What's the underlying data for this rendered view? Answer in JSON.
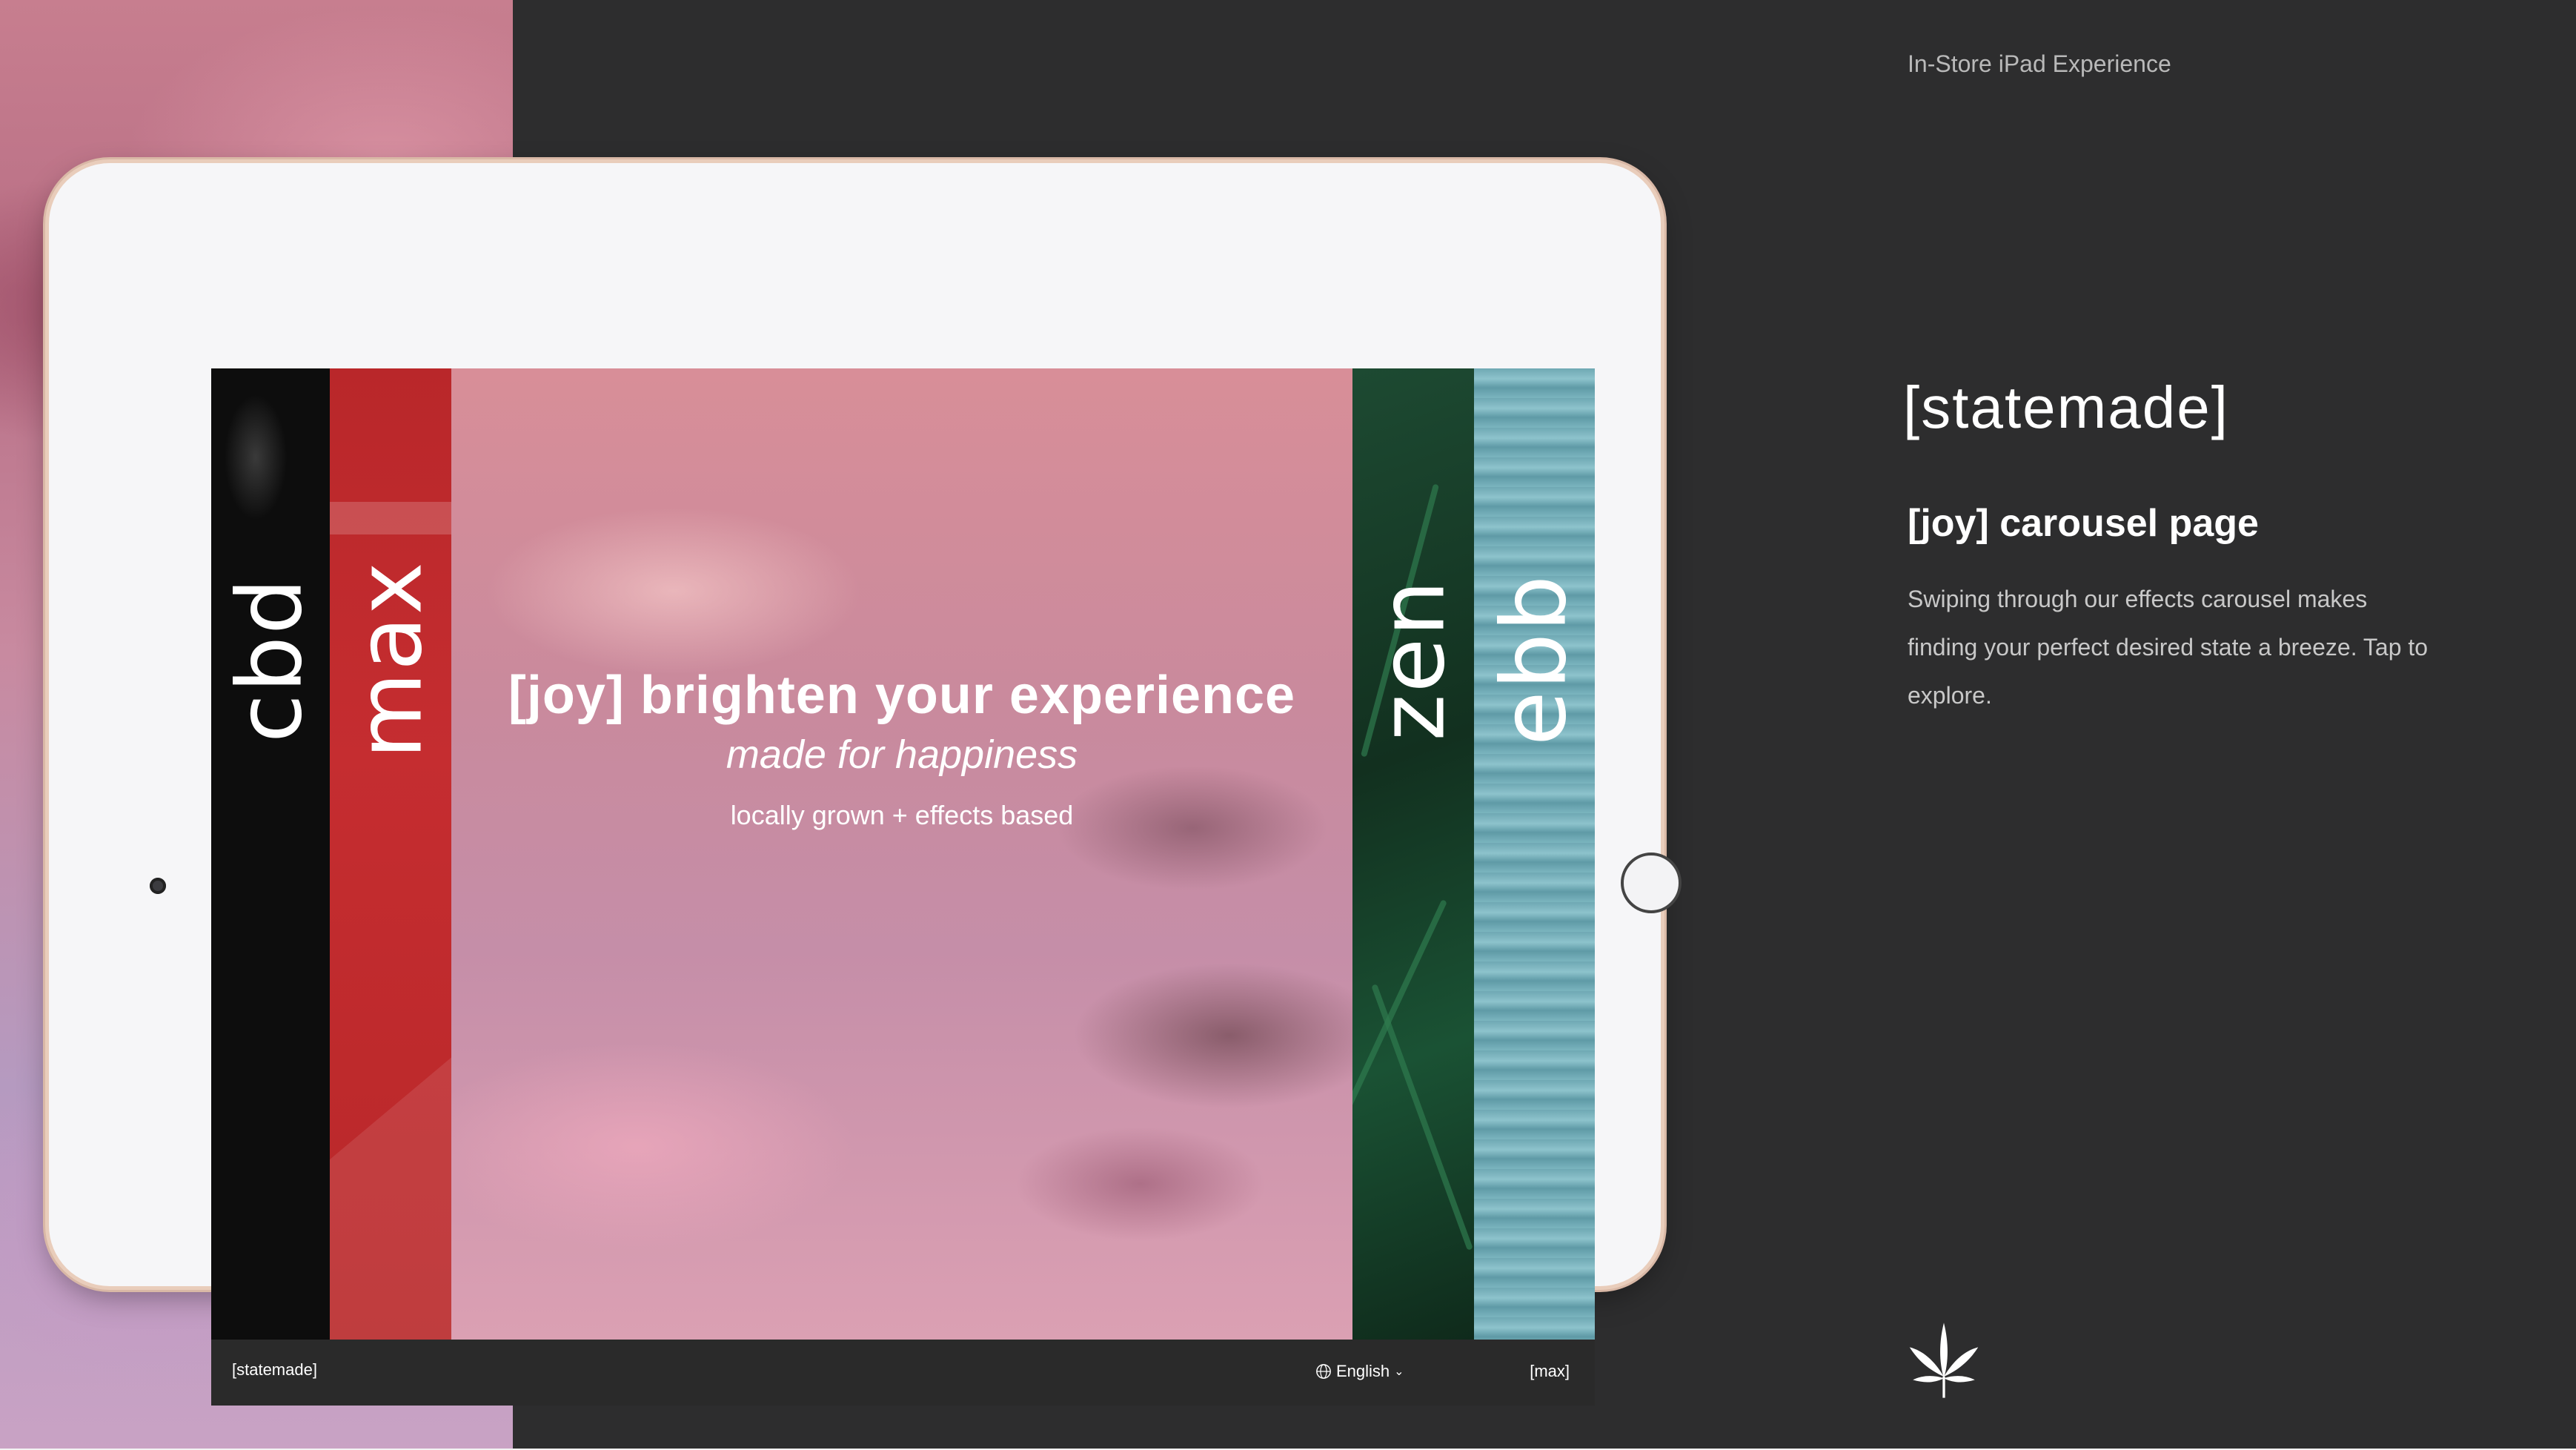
{
  "header": {
    "title": "In-Store iPad Experience"
  },
  "info": {
    "brand": "[statemade]",
    "title": "[joy] carousel page",
    "description": "Swiping  through our effects carousel makes finding your perfect desired state a breeze. Tap to explore."
  },
  "screen": {
    "panels": [
      {
        "label": "cbd"
      },
      {
        "label": "max"
      },
      {
        "label": "zen"
      },
      {
        "label": "ebb"
      }
    ],
    "hero": {
      "title": "[joy] brighten your experience",
      "subtitle": "made for happiness",
      "tagline": "locally grown + effects based"
    },
    "footer": {
      "brand": "[statemade]",
      "language": "English",
      "language_icon": "globe-icon",
      "chevron_icon": "chevron-down-icon",
      "current_effect": "[max]"
    }
  },
  "icons": {
    "logo": "cannabis-leaf-icon"
  },
  "colors": {
    "background": "#2d2d2e",
    "max_red": "#c52d30",
    "zen_green": "#1a5234",
    "ebb_teal": "#7bb5bf"
  }
}
